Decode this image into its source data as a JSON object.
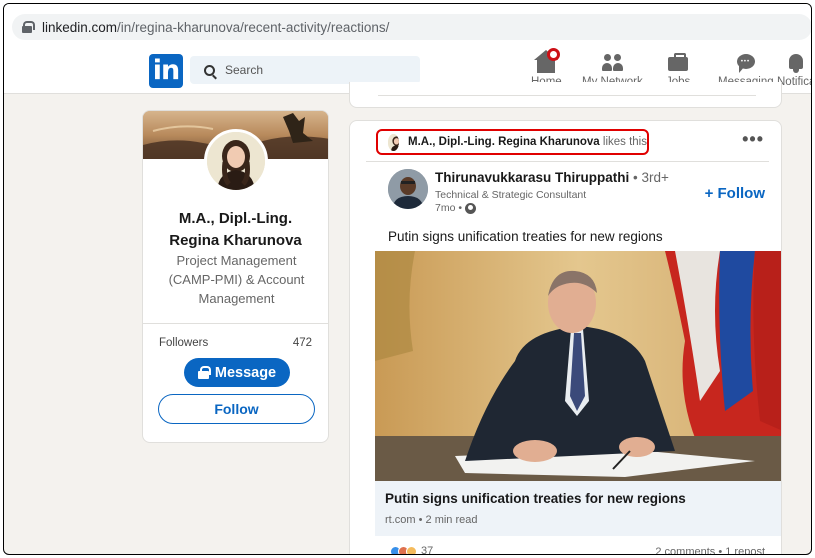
{
  "browser": {
    "url_domain": "linkedin.com",
    "url_path": "/in/regina-kharunova/recent-activity/reactions/"
  },
  "nav": {
    "logo": "in",
    "search_placeholder": "Search",
    "items": [
      {
        "label": "Home",
        "icon": "home-icon"
      },
      {
        "label": "My Network",
        "icon": "network-icon"
      },
      {
        "label": "Jobs",
        "icon": "briefcase-icon"
      },
      {
        "label": "Messaging",
        "icon": "messaging-icon"
      },
      {
        "label": "Notifica",
        "icon": "bell-icon"
      }
    ]
  },
  "profile": {
    "name_line1": "M.A., Dipl.-Ling.",
    "name_line2": "Regina Kharunova",
    "headline": "Project Management (CAMP-PMI) & Account Management",
    "followers_label": "Followers",
    "followers_count": "472",
    "message_label": "Message",
    "follow_label": "Follow"
  },
  "post": {
    "liked_by_name": "M.A., Dipl.-Ling. Regina Kharunova",
    "liked_by_suffix": "likes this",
    "more_label": "•••",
    "author_name": "Thirunavukkarasu Thiruppathi",
    "author_degree": "• 3rd+",
    "author_title": "Technical & Strategic Consultant",
    "author_time": "7mo •",
    "follow_label": "+ Follow",
    "text": "Putin signs unification treaties for new regions",
    "article_title": "Putin signs unification treaties for new regions",
    "article_source": "rt.com • 2 min read",
    "reaction_count": "37",
    "comments_reposts": "2 comments • 1 repost"
  },
  "colors": {
    "brand": "#0a66c2",
    "highlight_border": "#e00000",
    "page_bg": "#f4f2ee"
  }
}
